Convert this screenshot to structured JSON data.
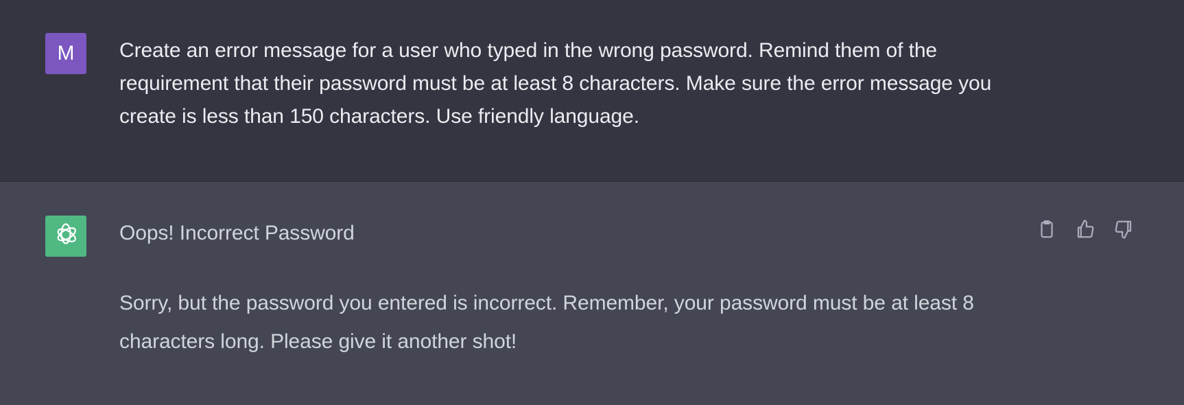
{
  "user_turn": {
    "avatar_initial": "M",
    "avatar_color": "#7b57bf",
    "message": "Create an error message for a user who typed in the wrong password. Remind them of the requirement that their password must be at least 8 characters. Make sure the error message you create is less than 150 characters. Use friendly language."
  },
  "assistant_turn": {
    "avatar_icon": "openai-logo-icon",
    "avatar_color": "#4fb883",
    "heading": "Oops! Incorrect Password",
    "body": "Sorry, but the password you entered is incorrect. Remember, your password must be at least 8 characters long. Please give it another shot!",
    "actions": [
      {
        "icon": "clipboard-icon"
      },
      {
        "icon": "thumbs-up-icon"
      },
      {
        "icon": "thumbs-down-icon"
      }
    ]
  },
  "colors": {
    "user_bg": "#343541",
    "assistant_bg": "#444654",
    "text": "#ececf1",
    "muted_text": "#d1d5db",
    "icon": "#acacbe"
  }
}
